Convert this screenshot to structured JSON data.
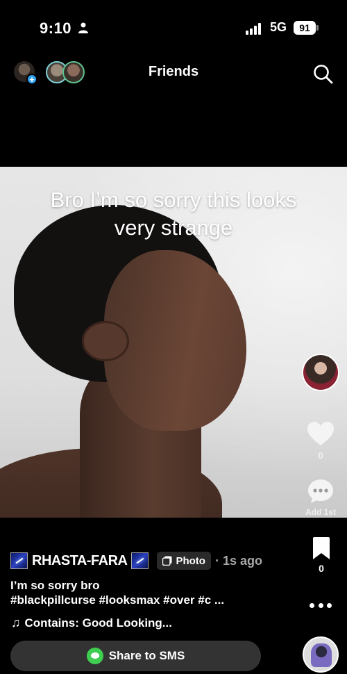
{
  "status_bar": {
    "time": "9:10",
    "network": "5G",
    "battery": "91"
  },
  "nav": {
    "title": "Friends"
  },
  "post": {
    "overlay_text_line1": "Bro I’m so sorry this looks",
    "overlay_text_line2": "very strange",
    "author": "RHASTA-FARA",
    "type_badge": "Photo",
    "posted_ago": "· 1s ago",
    "caption_line1": "I’m so sorry bro",
    "caption_line2": "#blackpillcurse #looksmax #over #c ...",
    "music_note": "♫",
    "music": "Contains: Good Looking..."
  },
  "actions": {
    "likes": "0",
    "comment_label": "Add 1st",
    "saves": "0",
    "share_label": "Share to SMS"
  },
  "icons": {
    "search": "search-icon",
    "like": "heart-icon",
    "comment": "comment-icon",
    "save": "bookmark-icon",
    "more": "more-icon",
    "sms": "sms-icon"
  },
  "colors": {
    "background": "#000000",
    "share_bar": "#333333",
    "sms_green": "#3fcd52",
    "add_blue": "#2ea3f2",
    "muted_text": "#a8a8a8"
  }
}
